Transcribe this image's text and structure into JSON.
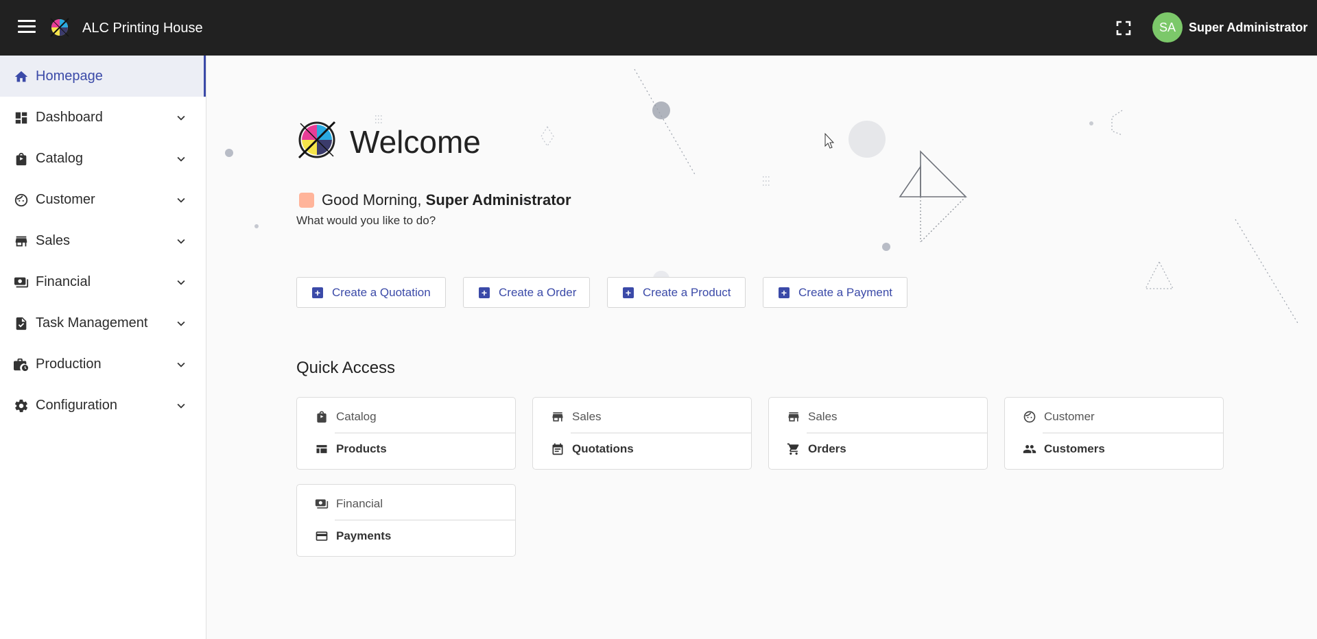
{
  "app": {
    "title": "ALC Printing House"
  },
  "user": {
    "initials": "SA",
    "name": "Super Administrator"
  },
  "sidebar": {
    "items": [
      {
        "label": "Homepage",
        "icon": "home-icon"
      },
      {
        "label": "Dashboard",
        "icon": "dashboard-icon"
      },
      {
        "label": "Catalog",
        "icon": "shopping-bag-icon"
      },
      {
        "label": "Customer",
        "icon": "face-icon"
      },
      {
        "label": "Sales",
        "icon": "store-icon"
      },
      {
        "label": "Financial",
        "icon": "payments-icon"
      },
      {
        "label": "Task Management",
        "icon": "task-icon"
      },
      {
        "label": "Production",
        "icon": "work-history-icon"
      },
      {
        "label": "Configuration",
        "icon": "gear-icon"
      }
    ]
  },
  "main": {
    "welcome": "Welcome",
    "greeting_prefix": "Good Morning,",
    "greeting_name": "Super Administrator",
    "subtitle": "What would you like to do?",
    "actions": [
      {
        "label": "Create a Quotation"
      },
      {
        "label": "Create a Order"
      },
      {
        "label": "Create a Product"
      },
      {
        "label": "Create a Payment"
      }
    ],
    "quick_access_title": "Quick Access",
    "quick_access": [
      {
        "category": "Catalog",
        "category_icon": "shopping-bag-icon",
        "item": "Products",
        "item_icon": "table-icon"
      },
      {
        "category": "Sales",
        "category_icon": "store-icon",
        "item": "Quotations",
        "item_icon": "calendar-icon"
      },
      {
        "category": "Sales",
        "category_icon": "store-icon",
        "item": "Orders",
        "item_icon": "cart-icon"
      },
      {
        "category": "Customer",
        "category_icon": "face-icon",
        "item": "Customers",
        "item_icon": "people-icon"
      },
      {
        "category": "Financial",
        "category_icon": "payments-icon",
        "item": "Payments",
        "item_icon": "credit-card-icon"
      }
    ]
  },
  "colors": {
    "accent": "#3b4aa8",
    "topbar": "#212121",
    "avatar": "#7cc86a"
  }
}
